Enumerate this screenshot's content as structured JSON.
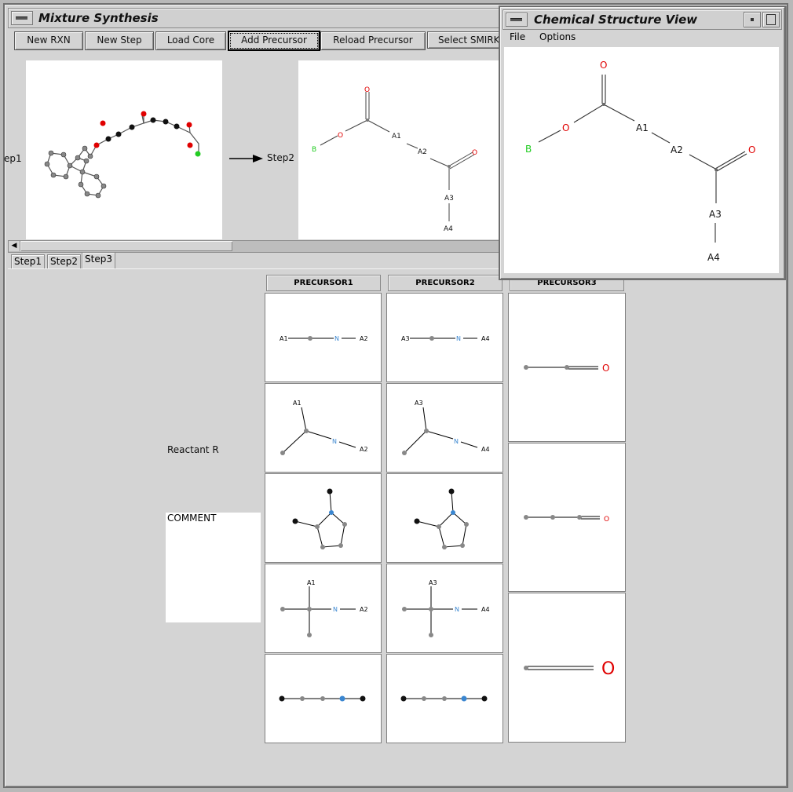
{
  "main_window": {
    "title": "Mixture Synthesis",
    "toolbar": {
      "new_rxn": "New RXN",
      "new_step": "New Step",
      "load_core": "Load Core",
      "add_precursor": "Add Precursor",
      "reload_precursor": "Reload Precursor",
      "select_smirks": "Select SMIRK"
    },
    "step_panel": {
      "step1_label": "ep1",
      "step2_label": "Step2"
    },
    "tabs": [
      "Step1",
      "Step2",
      "Step3"
    ],
    "selected_tab": "Step3",
    "precursor_headers": [
      "PRECURSOR1",
      "PRECURSOR2",
      "PRECURSOR3"
    ],
    "reactant_label": "Reactant R",
    "comment_label": "COMMENT"
  },
  "structure_window": {
    "title": "Chemical Structure View",
    "menu": [
      "File",
      "Options"
    ],
    "atom_labels": {
      "o1": "O",
      "b": "B",
      "a1": "A1",
      "a2": "A2",
      "o2": "O",
      "a3": "A3",
      "a4": "A4"
    }
  },
  "step2_structure": {
    "atom_labels": {
      "o1": "O",
      "o2": "O",
      "b": "B",
      "a1": "A1",
      "a2": "A2",
      "o3": "O",
      "a3": "A3",
      "a4": "A4"
    }
  },
  "precursor1_cells": {
    "c1": {
      "left": "A1",
      "n": "N",
      "right": "A2"
    },
    "c2": {
      "top": "A1",
      "n": "N",
      "right": "A2"
    },
    "c4": {
      "top": "A1",
      "n": "N",
      "right": "A2"
    }
  },
  "precursor2_cells": {
    "c1": {
      "left": "A3",
      "n": "N",
      "right": "A4"
    },
    "c2": {
      "top": "A3",
      "n": "N",
      "right": "A4"
    },
    "c4": {
      "top": "A3",
      "n": "N",
      "right": "A4"
    }
  },
  "precursor3_cells": {
    "o1": "O",
    "o2": "O",
    "o3": "O"
  },
  "colors": {
    "oxygen": "#e00000",
    "nitrogen": "#3a86d0",
    "boron": "#22cc22",
    "carbon": "#7f7f7f"
  }
}
